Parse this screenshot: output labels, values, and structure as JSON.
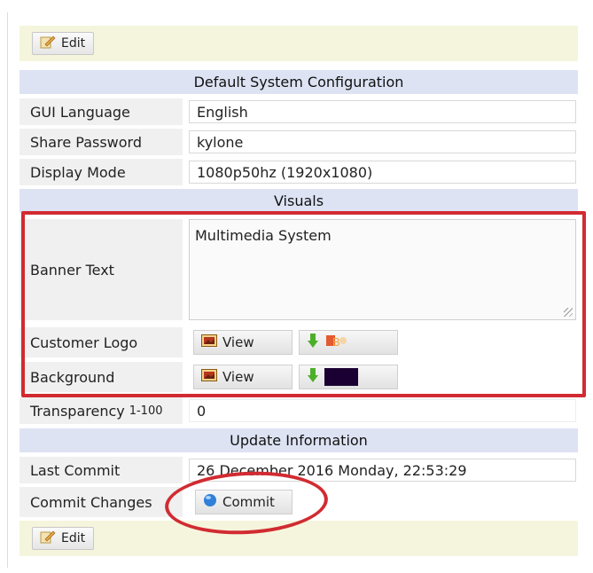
{
  "toolbar": {
    "edit_label": "Edit"
  },
  "sections": {
    "default_config": "Default System Configuration",
    "visuals": "Visuals",
    "update_info": "Update Information"
  },
  "fields": {
    "gui_language": {
      "label": "GUI Language",
      "value": "English"
    },
    "share_password": {
      "label": "Share Password",
      "value": "kylone"
    },
    "display_mode": {
      "label": "Display Mode",
      "value": "1080p50hz (1920x1080)"
    },
    "banner_text": {
      "label": "Banner Text",
      "value": "Multimedia System"
    },
    "customer_logo": {
      "label": "Customer Logo",
      "view_label": "View"
    },
    "background": {
      "label": "Background",
      "view_label": "View",
      "swatch_color": "#1a0033"
    },
    "transparency": {
      "label": "Transparency",
      "range": "1-100",
      "value": "0"
    },
    "last_commit": {
      "label": "Last Commit",
      "value": "26 December 2016 Monday, 22:53:29"
    },
    "commit_changes": {
      "label": "Commit Changes",
      "button_label": "Commit"
    }
  },
  "icons": {
    "edit": "pencil-note-icon",
    "view": "image-icon",
    "upload": "green-arrow-down-icon",
    "logo_preview": "logo-preview-icon",
    "commit": "globe-icon"
  },
  "colors": {
    "highlight_red": "#d12b31",
    "section_bg": "#dde3f3",
    "toolbar_bg": "#f5f5dd"
  }
}
